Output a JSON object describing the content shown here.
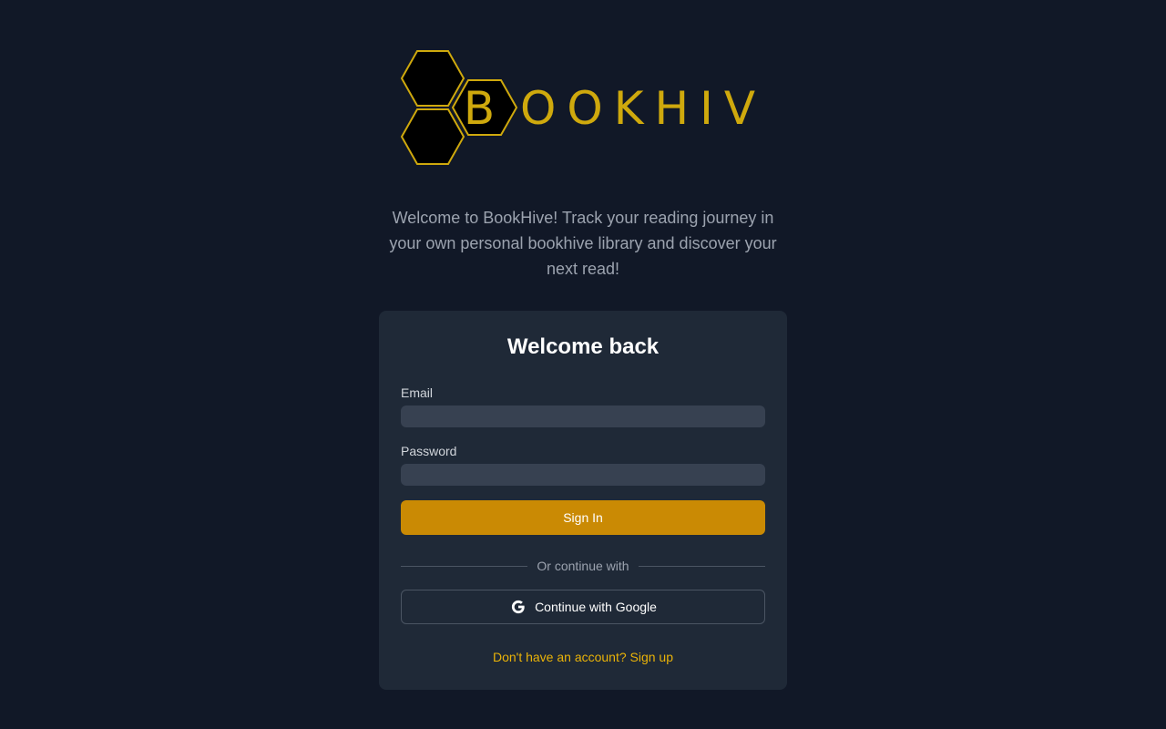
{
  "brand": {
    "logo_letter": "B",
    "logo_wordmark": "OOKHIVE",
    "accent_color": "#cfa90d"
  },
  "intro": {
    "text": "Welcome to BookHive! Track your reading journey in your own personal bookhive library and discover your next read!"
  },
  "login_card": {
    "title": "Welcome back",
    "email_label": "Email",
    "email_value": "",
    "email_placeholder": "",
    "password_label": "Password",
    "password_value": "",
    "password_placeholder": "",
    "sign_in_label": "Sign In",
    "divider_text": "Or continue with",
    "google_label": "Continue with Google",
    "google_icon": "google-icon",
    "signup_text": "Don't have an account? Sign up"
  },
  "colors": {
    "background": "#111827",
    "card": "#1f2937",
    "input": "#374151",
    "primary_button": "#ca8a04",
    "link": "#eab308"
  }
}
